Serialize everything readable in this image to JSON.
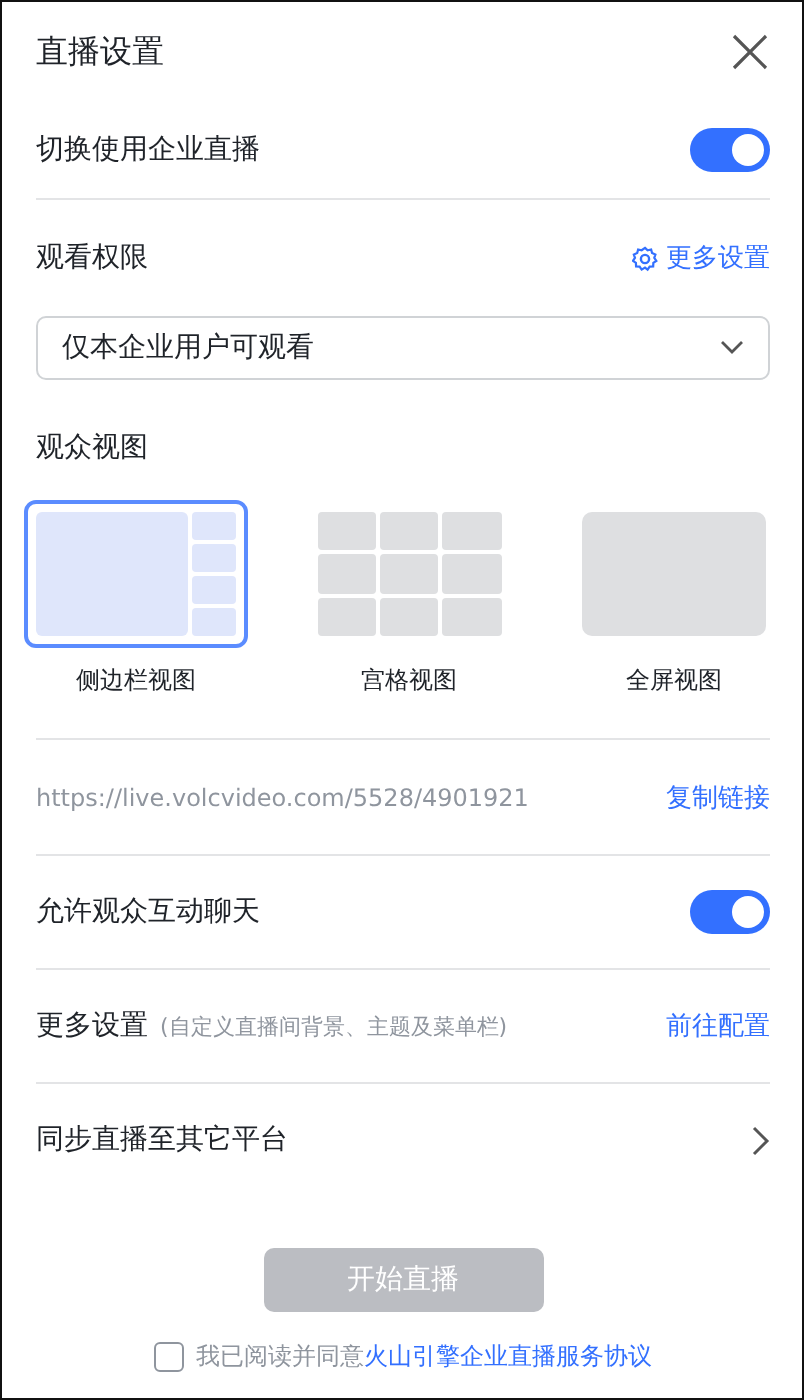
{
  "dialog": {
    "title": "直播设置"
  },
  "enterprise_toggle": {
    "label": "切换使用企业直播",
    "on": true
  },
  "permission": {
    "label": "观看权限",
    "link": "更多设置",
    "value": "仅本企业用户可观看"
  },
  "viewer_view": {
    "label": "观众视图",
    "options": [
      {
        "kind": "sidebar",
        "label": "侧边栏视图",
        "selected": true
      },
      {
        "kind": "grid",
        "label": "宫格视图",
        "selected": false
      },
      {
        "kind": "fullscreen",
        "label": "全屏视图",
        "selected": false
      }
    ]
  },
  "link_row": {
    "url": "https://live.volcvideo.com/5528/4901921",
    "action": "复制链接"
  },
  "chat_toggle": {
    "label": "允许观众互动聊天",
    "on": true
  },
  "more_settings": {
    "label": "更多设置",
    "hint": "(自定义直播间背景、主题及菜单栏)",
    "action": "前往配置"
  },
  "sync_row": {
    "label": "同步直播至其它平台"
  },
  "start_button": {
    "label": "开始直播",
    "disabled": true
  },
  "agreement": {
    "checked": false,
    "text": "我已阅读并同意",
    "link": "火山引擎企业直播服务协议"
  }
}
